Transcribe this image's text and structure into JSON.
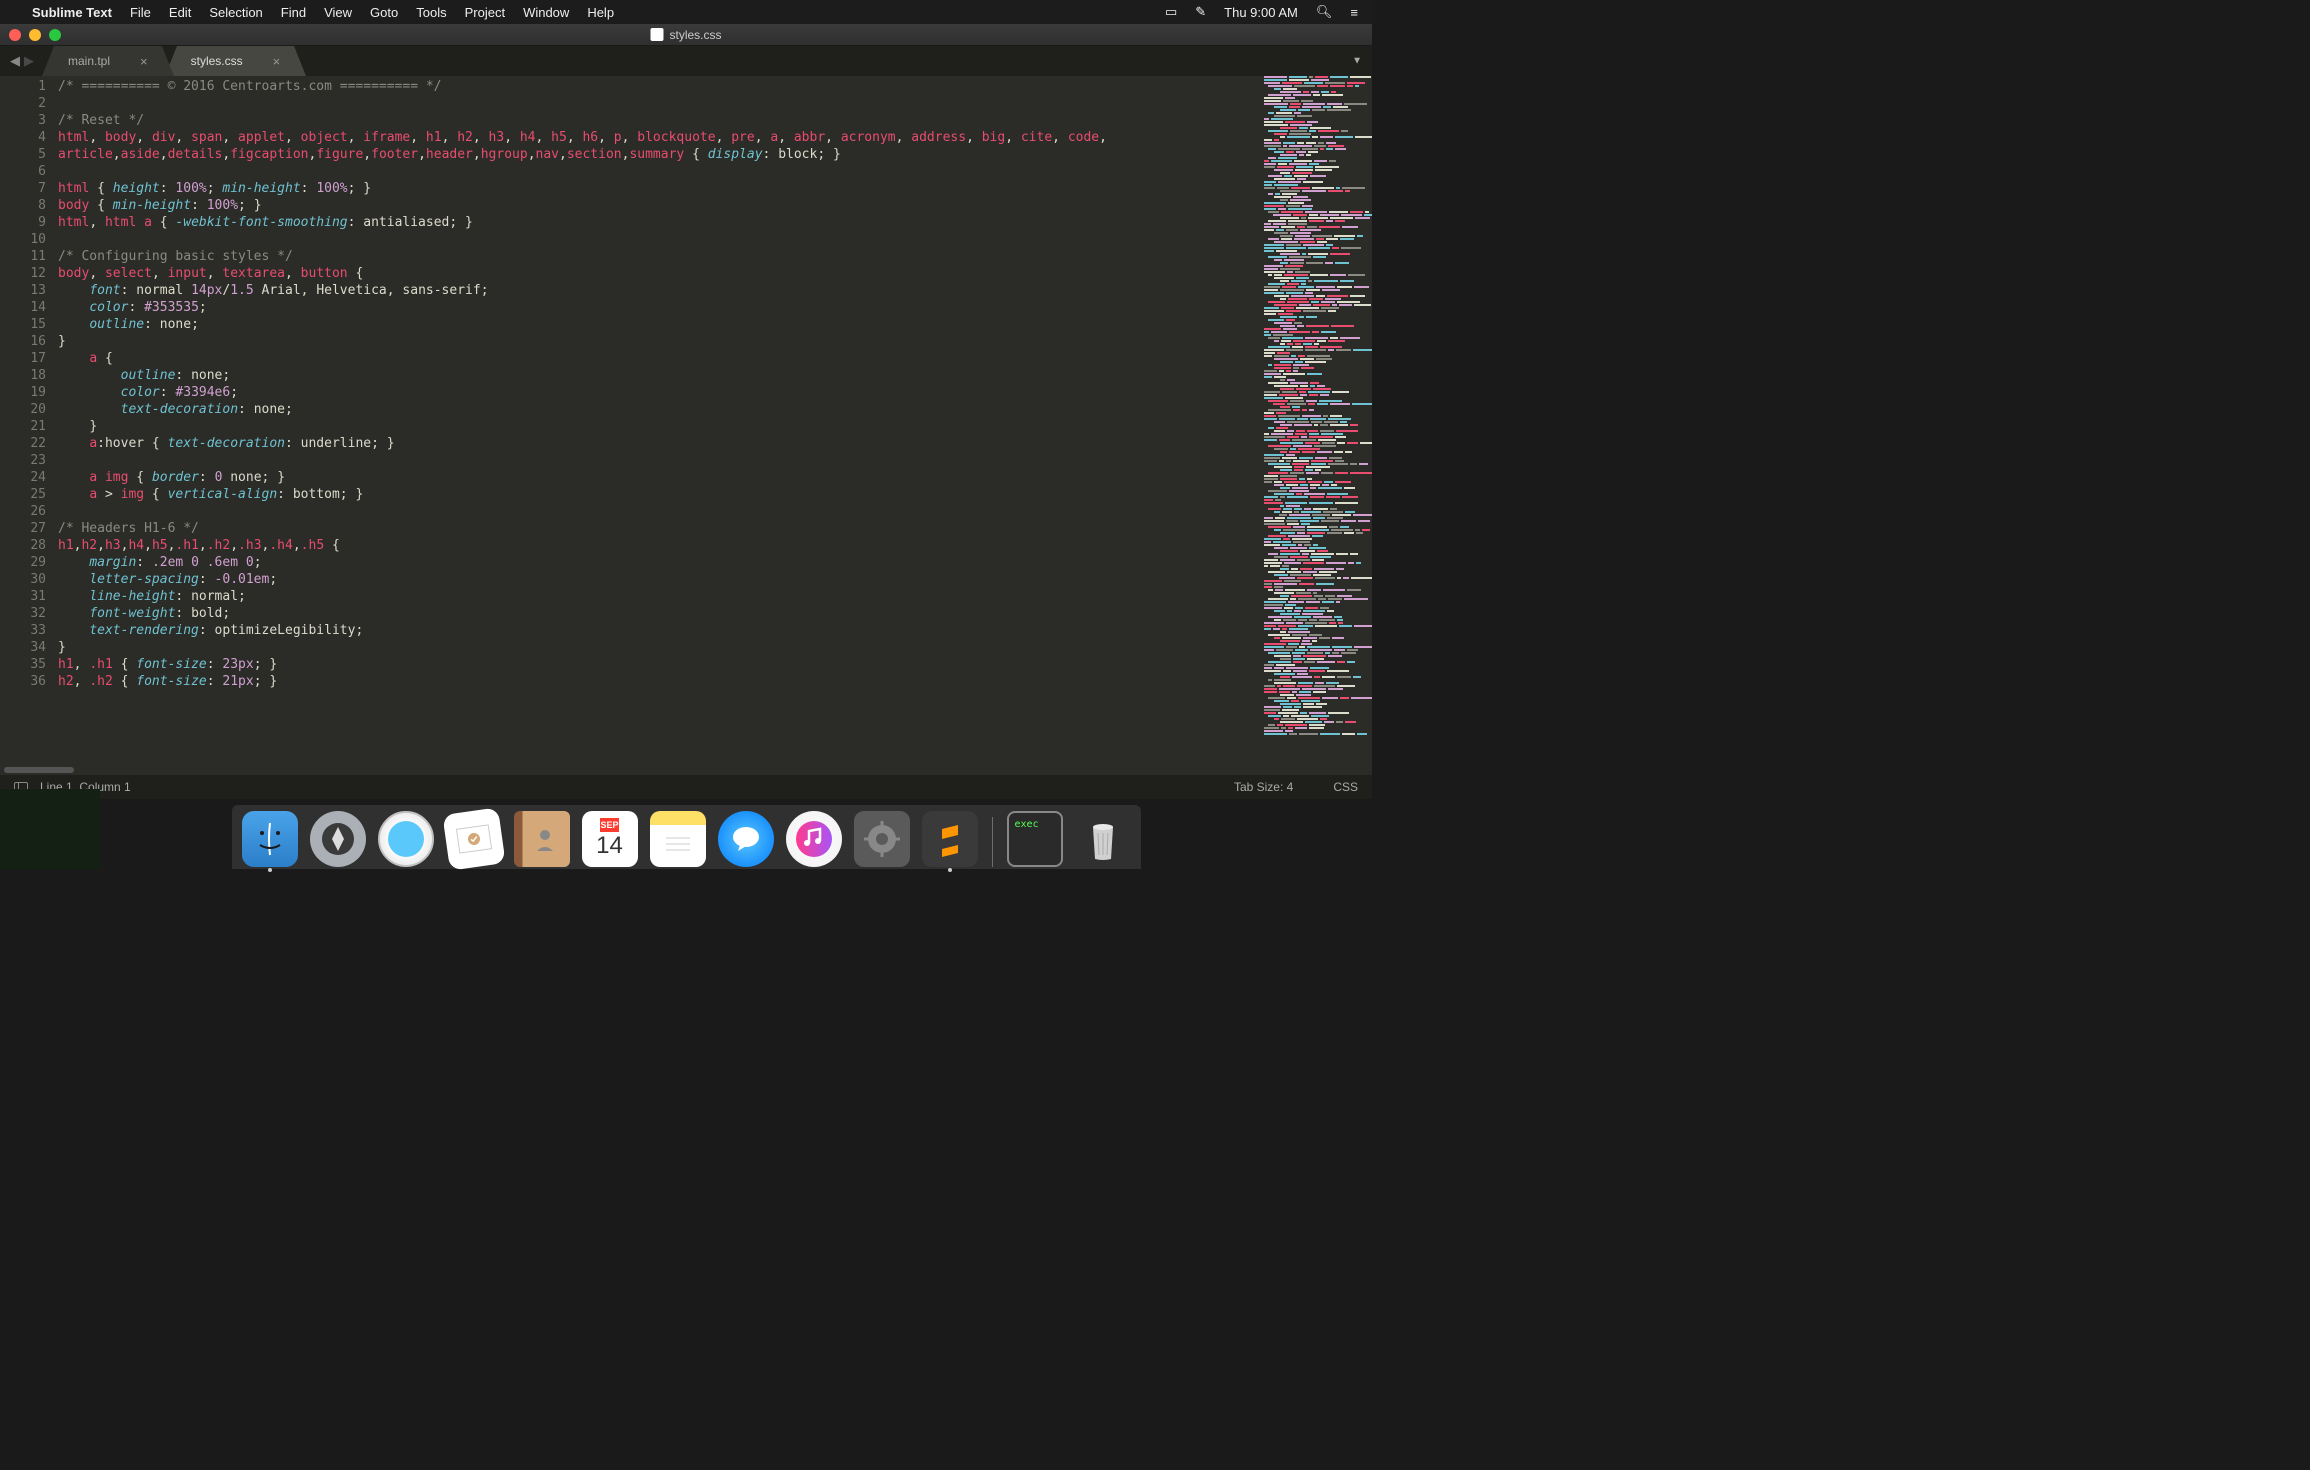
{
  "menubar": {
    "app_name": "Sublime Text",
    "items": [
      "File",
      "Edit",
      "Selection",
      "Find",
      "View",
      "Goto",
      "Tools",
      "Project",
      "Window",
      "Help"
    ],
    "clock": "Thu 9:00 AM"
  },
  "titlebar": {
    "filename": "styles.css"
  },
  "tabs": [
    {
      "label": "main.tpl",
      "active": false
    },
    {
      "label": "styles.css",
      "active": true
    }
  ],
  "code_lines": [
    [
      {
        "c": "c-comment",
        "t": "/* ========== © 2016 Centroarts.com ========== */"
      }
    ],
    [],
    [
      {
        "c": "c-comment",
        "t": "/* Reset */"
      }
    ],
    [
      {
        "c": "c-sel",
        "t": "html"
      },
      {
        "c": "c-punct",
        "t": ", "
      },
      {
        "c": "c-sel",
        "t": "body"
      },
      {
        "c": "c-punct",
        "t": ", "
      },
      {
        "c": "c-sel",
        "t": "div"
      },
      {
        "c": "c-punct",
        "t": ", "
      },
      {
        "c": "c-sel",
        "t": "span"
      },
      {
        "c": "c-punct",
        "t": ", "
      },
      {
        "c": "c-sel",
        "t": "applet"
      },
      {
        "c": "c-punct",
        "t": ", "
      },
      {
        "c": "c-sel",
        "t": "object"
      },
      {
        "c": "c-punct",
        "t": ", "
      },
      {
        "c": "c-sel",
        "t": "iframe"
      },
      {
        "c": "c-punct",
        "t": ", "
      },
      {
        "c": "c-sel",
        "t": "h1"
      },
      {
        "c": "c-punct",
        "t": ", "
      },
      {
        "c": "c-sel",
        "t": "h2"
      },
      {
        "c": "c-punct",
        "t": ", "
      },
      {
        "c": "c-sel",
        "t": "h3"
      },
      {
        "c": "c-punct",
        "t": ", "
      },
      {
        "c": "c-sel",
        "t": "h4"
      },
      {
        "c": "c-punct",
        "t": ", "
      },
      {
        "c": "c-sel",
        "t": "h5"
      },
      {
        "c": "c-punct",
        "t": ", "
      },
      {
        "c": "c-sel",
        "t": "h6"
      },
      {
        "c": "c-punct",
        "t": ", "
      },
      {
        "c": "c-sel",
        "t": "p"
      },
      {
        "c": "c-punct",
        "t": ", "
      },
      {
        "c": "c-sel",
        "t": "blockquote"
      },
      {
        "c": "c-punct",
        "t": ", "
      },
      {
        "c": "c-sel",
        "t": "pre"
      },
      {
        "c": "c-punct",
        "t": ", "
      },
      {
        "c": "c-sel",
        "t": "a"
      },
      {
        "c": "c-punct",
        "t": ", "
      },
      {
        "c": "c-sel",
        "t": "abbr"
      },
      {
        "c": "c-punct",
        "t": ", "
      },
      {
        "c": "c-sel",
        "t": "acronym"
      },
      {
        "c": "c-punct",
        "t": ", "
      },
      {
        "c": "c-sel",
        "t": "address"
      },
      {
        "c": "c-punct",
        "t": ", "
      },
      {
        "c": "c-sel",
        "t": "big"
      },
      {
        "c": "c-punct",
        "t": ", "
      },
      {
        "c": "c-sel",
        "t": "cite"
      },
      {
        "c": "c-punct",
        "t": ", "
      },
      {
        "c": "c-sel",
        "t": "code"
      },
      {
        "c": "c-punct",
        "t": ", "
      }
    ],
    [
      {
        "c": "c-sel",
        "t": "article"
      },
      {
        "c": "c-punct",
        "t": ","
      },
      {
        "c": "c-sel",
        "t": "aside"
      },
      {
        "c": "c-punct",
        "t": ","
      },
      {
        "c": "c-sel",
        "t": "details"
      },
      {
        "c": "c-punct",
        "t": ","
      },
      {
        "c": "c-sel",
        "t": "figcaption"
      },
      {
        "c": "c-punct",
        "t": ","
      },
      {
        "c": "c-sel",
        "t": "figure"
      },
      {
        "c": "c-punct",
        "t": ","
      },
      {
        "c": "c-sel",
        "t": "footer"
      },
      {
        "c": "c-punct",
        "t": ","
      },
      {
        "c": "c-sel",
        "t": "header"
      },
      {
        "c": "c-punct",
        "t": ","
      },
      {
        "c": "c-sel",
        "t": "hgroup"
      },
      {
        "c": "c-punct",
        "t": ","
      },
      {
        "c": "c-sel",
        "t": "nav"
      },
      {
        "c": "c-punct",
        "t": ","
      },
      {
        "c": "c-sel",
        "t": "section"
      },
      {
        "c": "c-punct",
        "t": ","
      },
      {
        "c": "c-sel",
        "t": "summary"
      },
      {
        "c": "c-brace",
        "t": " { "
      },
      {
        "c": "c-prop",
        "t": "display"
      },
      {
        "c": "c-punct",
        "t": ": "
      },
      {
        "c": "c-val",
        "t": "block"
      },
      {
        "c": "c-punct",
        "t": "; "
      },
      {
        "c": "c-brace",
        "t": "}"
      }
    ],
    [],
    [
      {
        "c": "c-sel",
        "t": "html"
      },
      {
        "c": "c-brace",
        "t": " { "
      },
      {
        "c": "c-prop",
        "t": "height"
      },
      {
        "c": "c-punct",
        "t": ": "
      },
      {
        "c": "c-num",
        "t": "100%"
      },
      {
        "c": "c-punct",
        "t": "; "
      },
      {
        "c": "c-prop",
        "t": "min-height"
      },
      {
        "c": "c-punct",
        "t": ": "
      },
      {
        "c": "c-num",
        "t": "100%"
      },
      {
        "c": "c-punct",
        "t": "; "
      },
      {
        "c": "c-brace",
        "t": "}"
      }
    ],
    [
      {
        "c": "c-sel",
        "t": "body"
      },
      {
        "c": "c-brace",
        "t": " { "
      },
      {
        "c": "c-prop",
        "t": "min-height"
      },
      {
        "c": "c-punct",
        "t": ": "
      },
      {
        "c": "c-num",
        "t": "100%"
      },
      {
        "c": "c-punct",
        "t": "; "
      },
      {
        "c": "c-brace",
        "t": "}"
      }
    ],
    [
      {
        "c": "c-sel",
        "t": "html"
      },
      {
        "c": "c-punct",
        "t": ", "
      },
      {
        "c": "c-sel",
        "t": "html a"
      },
      {
        "c": "c-brace",
        "t": " { "
      },
      {
        "c": "c-prop",
        "t": "-webkit-font-smoothing"
      },
      {
        "c": "c-punct",
        "t": ": "
      },
      {
        "c": "c-val",
        "t": "antialiased"
      },
      {
        "c": "c-punct",
        "t": "; "
      },
      {
        "c": "c-brace",
        "t": "}"
      }
    ],
    [],
    [
      {
        "c": "c-comment",
        "t": "/* Configuring basic styles */"
      }
    ],
    [
      {
        "c": "c-sel",
        "t": "body"
      },
      {
        "c": "c-punct",
        "t": ", "
      },
      {
        "c": "c-sel",
        "t": "select"
      },
      {
        "c": "c-punct",
        "t": ", "
      },
      {
        "c": "c-sel",
        "t": "input"
      },
      {
        "c": "c-punct",
        "t": ", "
      },
      {
        "c": "c-sel",
        "t": "textarea"
      },
      {
        "c": "c-punct",
        "t": ", "
      },
      {
        "c": "c-sel",
        "t": "button"
      },
      {
        "c": "c-brace",
        "t": " {"
      }
    ],
    [
      {
        "c": "",
        "t": "    "
      },
      {
        "c": "c-prop",
        "t": "font"
      },
      {
        "c": "c-punct",
        "t": ": "
      },
      {
        "c": "c-val",
        "t": "normal "
      },
      {
        "c": "c-num",
        "t": "14px"
      },
      {
        "c": "c-punct",
        "t": "/"
      },
      {
        "c": "c-num",
        "t": "1.5"
      },
      {
        "c": "c-val",
        "t": " Arial, Helvetica, sans-serif"
      },
      {
        "c": "c-punct",
        "t": ";"
      }
    ],
    [
      {
        "c": "",
        "t": "    "
      },
      {
        "c": "c-prop",
        "t": "color"
      },
      {
        "c": "c-punct",
        "t": ": "
      },
      {
        "c": "c-num",
        "t": "#353535"
      },
      {
        "c": "c-punct",
        "t": ";"
      }
    ],
    [
      {
        "c": "",
        "t": "    "
      },
      {
        "c": "c-prop",
        "t": "outline"
      },
      {
        "c": "c-punct",
        "t": ": "
      },
      {
        "c": "c-val",
        "t": "none"
      },
      {
        "c": "c-punct",
        "t": ";"
      }
    ],
    [
      {
        "c": "c-brace",
        "t": "}"
      }
    ],
    [
      {
        "c": "",
        "t": "    "
      },
      {
        "c": "c-sel",
        "t": "a"
      },
      {
        "c": "c-brace",
        "t": " {"
      }
    ],
    [
      {
        "c": "",
        "t": "        "
      },
      {
        "c": "c-prop",
        "t": "outline"
      },
      {
        "c": "c-punct",
        "t": ": "
      },
      {
        "c": "c-val",
        "t": "none"
      },
      {
        "c": "c-punct",
        "t": ";"
      }
    ],
    [
      {
        "c": "",
        "t": "        "
      },
      {
        "c": "c-prop",
        "t": "color"
      },
      {
        "c": "c-punct",
        "t": ": "
      },
      {
        "c": "c-num",
        "t": "#3394e6"
      },
      {
        "c": "c-punct",
        "t": ";"
      }
    ],
    [
      {
        "c": "",
        "t": "        "
      },
      {
        "c": "c-prop",
        "t": "text-decoration"
      },
      {
        "c": "c-punct",
        "t": ": "
      },
      {
        "c": "c-val",
        "t": "none"
      },
      {
        "c": "c-punct",
        "t": ";"
      }
    ],
    [
      {
        "c": "",
        "t": "    "
      },
      {
        "c": "c-brace",
        "t": "}"
      }
    ],
    [
      {
        "c": "",
        "t": "    "
      },
      {
        "c": "c-sel",
        "t": "a"
      },
      {
        "c": "c-punct",
        "t": ":hover"
      },
      {
        "c": "c-brace",
        "t": " { "
      },
      {
        "c": "c-prop",
        "t": "text-decoration"
      },
      {
        "c": "c-punct",
        "t": ": "
      },
      {
        "c": "c-val",
        "t": "underline"
      },
      {
        "c": "c-punct",
        "t": "; "
      },
      {
        "c": "c-brace",
        "t": "}"
      }
    ],
    [],
    [
      {
        "c": "",
        "t": "    "
      },
      {
        "c": "c-sel",
        "t": "a img"
      },
      {
        "c": "c-brace",
        "t": " { "
      },
      {
        "c": "c-prop",
        "t": "border"
      },
      {
        "c": "c-punct",
        "t": ": "
      },
      {
        "c": "c-num",
        "t": "0"
      },
      {
        "c": "c-val",
        "t": " none"
      },
      {
        "c": "c-punct",
        "t": "; "
      },
      {
        "c": "c-brace",
        "t": "}"
      }
    ],
    [
      {
        "c": "",
        "t": "    "
      },
      {
        "c": "c-sel",
        "t": "a "
      },
      {
        "c": "c-punct",
        "t": ">"
      },
      {
        "c": "c-sel",
        "t": " img"
      },
      {
        "c": "c-brace",
        "t": " { "
      },
      {
        "c": "c-prop",
        "t": "vertical-align"
      },
      {
        "c": "c-punct",
        "t": ": "
      },
      {
        "c": "c-val",
        "t": "bottom"
      },
      {
        "c": "c-punct",
        "t": "; "
      },
      {
        "c": "c-brace",
        "t": "}"
      }
    ],
    [],
    [
      {
        "c": "c-comment",
        "t": "/* Headers H1-6 */"
      }
    ],
    [
      {
        "c": "c-sel",
        "t": "h1"
      },
      {
        "c": "c-punct",
        "t": ","
      },
      {
        "c": "c-sel",
        "t": "h2"
      },
      {
        "c": "c-punct",
        "t": ","
      },
      {
        "c": "c-sel",
        "t": "h3"
      },
      {
        "c": "c-punct",
        "t": ","
      },
      {
        "c": "c-sel",
        "t": "h4"
      },
      {
        "c": "c-punct",
        "t": ","
      },
      {
        "c": "c-sel",
        "t": "h5"
      },
      {
        "c": "c-punct",
        "t": ","
      },
      {
        "c": "c-sel",
        "t": ".h1"
      },
      {
        "c": "c-punct",
        "t": ","
      },
      {
        "c": "c-sel",
        "t": ".h2"
      },
      {
        "c": "c-punct",
        "t": ","
      },
      {
        "c": "c-sel",
        "t": ".h3"
      },
      {
        "c": "c-punct",
        "t": ","
      },
      {
        "c": "c-sel",
        "t": ".h4"
      },
      {
        "c": "c-punct",
        "t": ","
      },
      {
        "c": "c-sel",
        "t": ".h5"
      },
      {
        "c": "c-brace",
        "t": " {"
      }
    ],
    [
      {
        "c": "",
        "t": "    "
      },
      {
        "c": "c-prop",
        "t": "margin"
      },
      {
        "c": "c-punct",
        "t": ": "
      },
      {
        "c": "c-num",
        "t": ".2em 0 .6em 0"
      },
      {
        "c": "c-punct",
        "t": ";"
      }
    ],
    [
      {
        "c": "",
        "t": "    "
      },
      {
        "c": "c-prop",
        "t": "letter-spacing"
      },
      {
        "c": "c-punct",
        "t": ": "
      },
      {
        "c": "c-num",
        "t": "-0.01em"
      },
      {
        "c": "c-punct",
        "t": ";"
      }
    ],
    [
      {
        "c": "",
        "t": "    "
      },
      {
        "c": "c-prop",
        "t": "line-height"
      },
      {
        "c": "c-punct",
        "t": ": "
      },
      {
        "c": "c-val",
        "t": "normal"
      },
      {
        "c": "c-punct",
        "t": ";"
      }
    ],
    [
      {
        "c": "",
        "t": "    "
      },
      {
        "c": "c-prop",
        "t": "font-weight"
      },
      {
        "c": "c-punct",
        "t": ": "
      },
      {
        "c": "c-val",
        "t": "bold"
      },
      {
        "c": "c-punct",
        "t": ";"
      }
    ],
    [
      {
        "c": "",
        "t": "    "
      },
      {
        "c": "c-prop",
        "t": "text-rendering"
      },
      {
        "c": "c-punct",
        "t": ": "
      },
      {
        "c": "c-val",
        "t": "optimizeLegibility"
      },
      {
        "c": "c-punct",
        "t": ";"
      }
    ],
    [
      {
        "c": "c-brace",
        "t": "}"
      }
    ],
    [
      {
        "c": "c-sel",
        "t": "h1"
      },
      {
        "c": "c-punct",
        "t": ", "
      },
      {
        "c": "c-sel",
        "t": ".h1"
      },
      {
        "c": "c-brace",
        "t": " { "
      },
      {
        "c": "c-prop",
        "t": "font-size"
      },
      {
        "c": "c-punct",
        "t": ": "
      },
      {
        "c": "c-num",
        "t": "23px"
      },
      {
        "c": "c-punct",
        "t": "; "
      },
      {
        "c": "c-brace",
        "t": "}"
      }
    ],
    [
      {
        "c": "c-sel",
        "t": "h2"
      },
      {
        "c": "c-punct",
        "t": ", "
      },
      {
        "c": "c-sel",
        "t": ".h2"
      },
      {
        "c": "c-brace",
        "t": " { "
      },
      {
        "c": "c-prop",
        "t": "font-size"
      },
      {
        "c": "c-punct",
        "t": ": "
      },
      {
        "c": "c-num",
        "t": "21px"
      },
      {
        "c": "c-punct",
        "t": "; "
      },
      {
        "c": "c-brace",
        "t": "}"
      }
    ]
  ],
  "statusbar": {
    "position": "Line 1, Column 1",
    "tab_size": "Tab Size: 4",
    "syntax": "CSS"
  },
  "dock": {
    "calendar": {
      "month": "SEP",
      "day": "14"
    },
    "terminal_label": "exec"
  }
}
